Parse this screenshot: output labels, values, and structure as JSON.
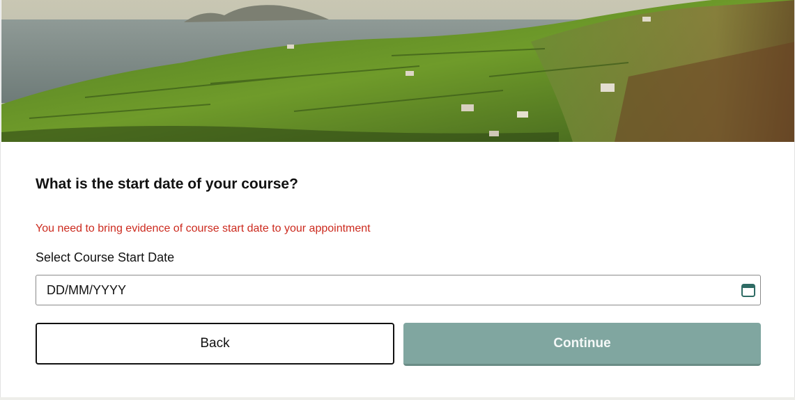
{
  "form": {
    "question": "What is the start date of your course?",
    "notice": "You need to bring evidence of course start date to your appointment",
    "field_label": "Select Course Start Date",
    "date_placeholder": "DD/MM/YYYY"
  },
  "buttons": {
    "back_label": "Back",
    "continue_label": "Continue"
  },
  "icons": {
    "date_picker": "calendar-icon"
  },
  "colors": {
    "error_text": "#cc2a1e",
    "continue_disabled_bg": "#80a6a0",
    "calendar_icon": "#2e6b64"
  }
}
